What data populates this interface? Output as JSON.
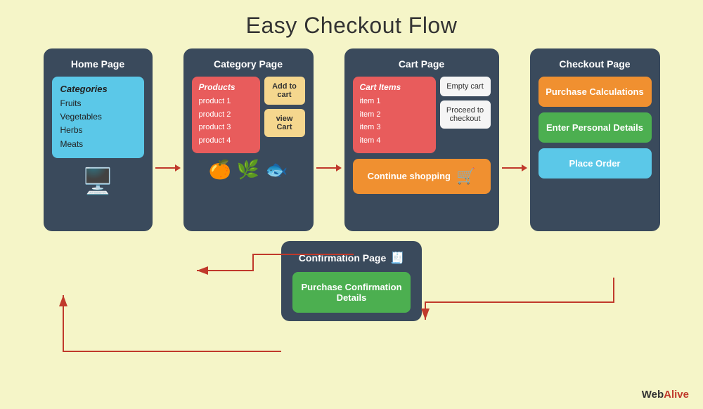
{
  "page": {
    "title": "Easy Checkout Flow"
  },
  "home_page": {
    "title": "Home Page",
    "categories_title": "Categories",
    "categories_items": [
      "Fruits",
      "Vegetables",
      "Herbs",
      "Meats"
    ]
  },
  "category_page": {
    "title": "Category Page",
    "products_title": "Products",
    "products": [
      "product 1",
      "product 2",
      "product 3",
      "product 4"
    ],
    "add_to_cart_label": "Add to cart",
    "view_cart_label": "view Cart"
  },
  "cart_page": {
    "title": "Cart Page",
    "cart_items_title": "Cart Items",
    "items": [
      "item 1",
      "item 2",
      "item 3",
      "item 4"
    ],
    "empty_cart_label": "Empty cart",
    "proceed_label": "Proceed to checkout",
    "continue_shopping_label": "Continue shopping"
  },
  "checkout_page": {
    "title": "Checkout Page",
    "purchase_calc_label": "Purchase Calculations",
    "personal_details_label": "Enter Personal Details",
    "place_order_label": "Place Order"
  },
  "confirmation_page": {
    "title": "Confirmation Page",
    "details_label": "Purchase Confirmation Details"
  },
  "branding": {
    "prefix": "Web",
    "suffix": "Alive"
  }
}
